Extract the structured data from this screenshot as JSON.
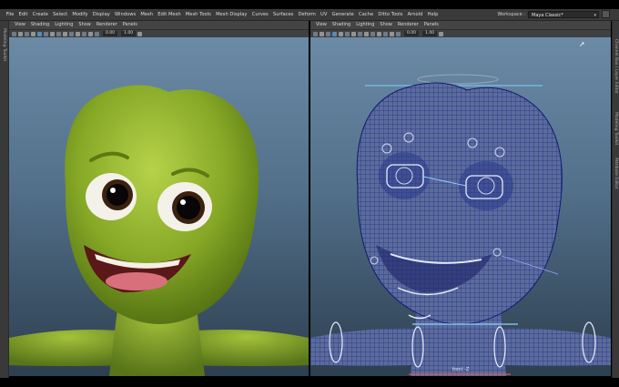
{
  "menubar": {
    "items": [
      "File",
      "Edit",
      "Create",
      "Select",
      "Modify",
      "Display",
      "Windows",
      "Mesh",
      "Edit Mesh",
      "Mesh Tools",
      "Mesh Display",
      "Curves",
      "Surfaces",
      "Deform",
      "UV",
      "Generate",
      "Cache",
      "Ditto Tools",
      "Arnold",
      "Help"
    ]
  },
  "workspace": {
    "label": "Workspace :",
    "value": "Maya Classic*"
  },
  "panels": {
    "left": {
      "menu": [
        "View",
        "Shading",
        "Lighting",
        "Show",
        "Renderer",
        "Panels"
      ],
      "field_a": "0.00",
      "field_b": "1.00"
    },
    "right": {
      "menu": [
        "View",
        "Shading",
        "Lighting",
        "Show",
        "Renderer",
        "Panels"
      ],
      "field_a": "0.00",
      "field_b": "1.00",
      "camera_label": "front -Z"
    }
  },
  "side_tabs": {
    "left": "Modeling Toolkit",
    "right_a": "Channel Box / Layer Editor",
    "right_b": "Modeling Toolkit",
    "right_c": "Attribute Editor"
  },
  "colors": {
    "menubar_bg": "#3a3a3a",
    "viewport_top": "#6b8aa6",
    "viewport_bottom": "#2e3f4f",
    "character_green": "#8bb02a",
    "wireframe_blue": "#1c2a8f",
    "control_curve": "#7fd0ff"
  }
}
